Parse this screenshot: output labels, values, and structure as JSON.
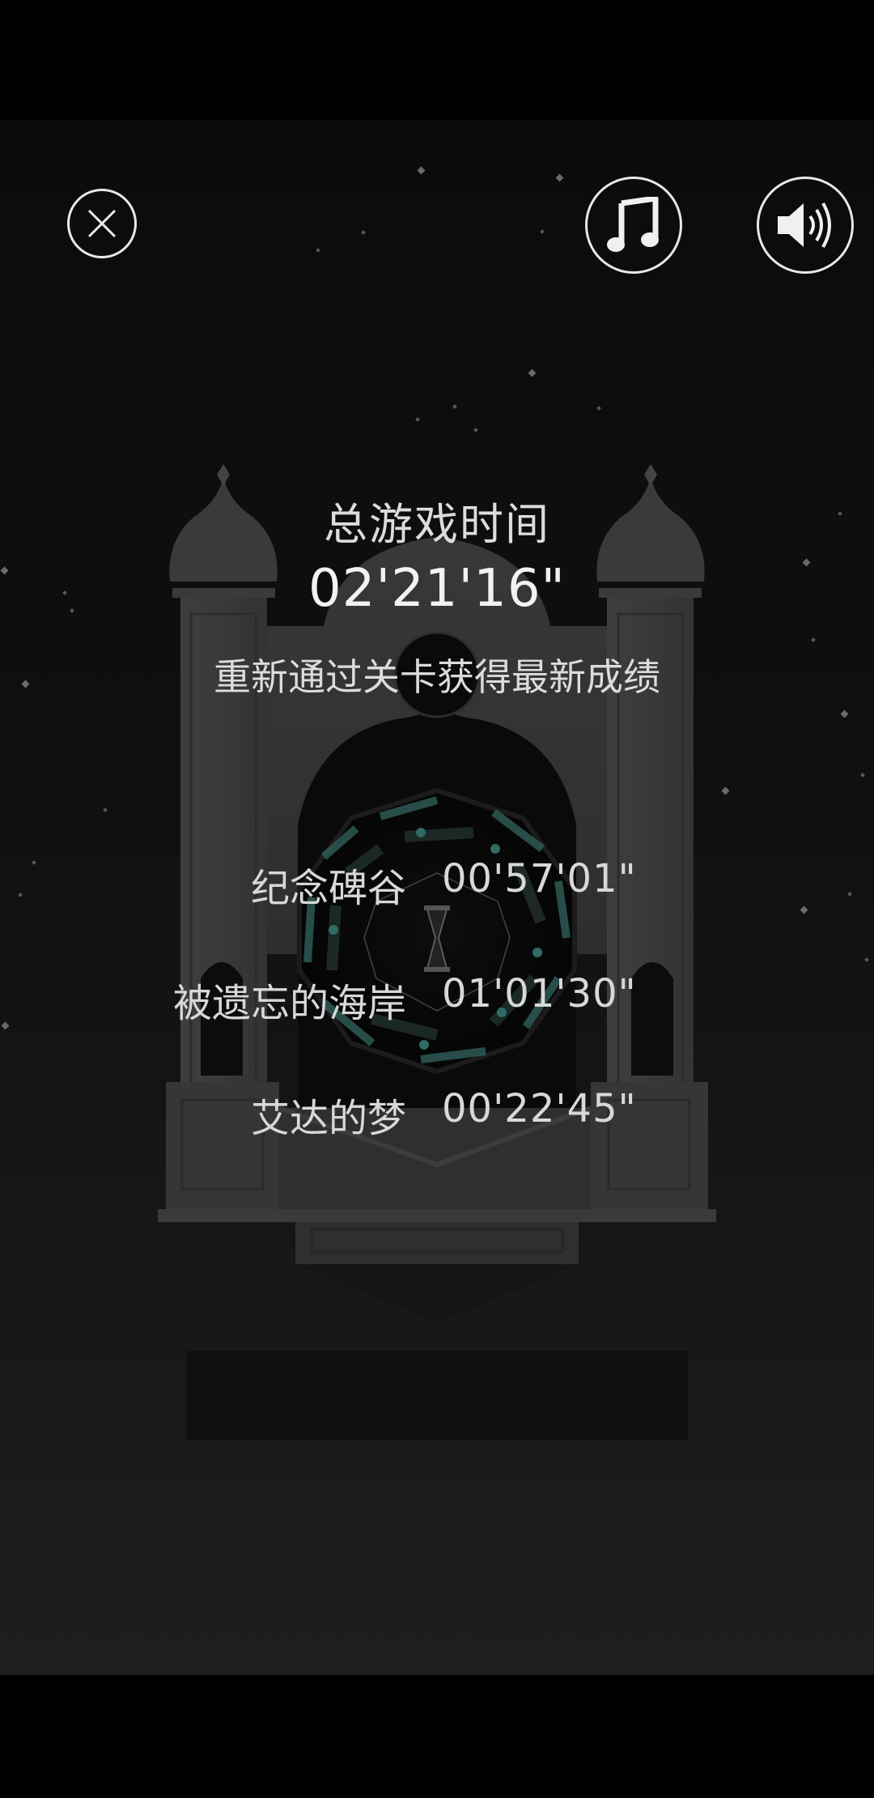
{
  "header": {
    "close_icon": "close-circle-icon",
    "music_icon": "music-note-icon",
    "sound_icon": "speaker-volume-icon"
  },
  "summary": {
    "total_time_label": "总游戏时间",
    "total_time_value": "02'21'16\"",
    "replay_hint": "重新通过关卡获得最新成绩"
  },
  "records": [
    {
      "name": "纪念碑谷",
      "time": "00'57'01\""
    },
    {
      "name": "被遗忘的海岸",
      "time": "01'01'30\""
    },
    {
      "name": "艾达的梦",
      "time": "00'22'45\""
    }
  ],
  "colors": {
    "background": "#000000",
    "text": "#dcdcdc",
    "monument": "#3a3a3a",
    "accent_teal": "#2f5a55"
  }
}
